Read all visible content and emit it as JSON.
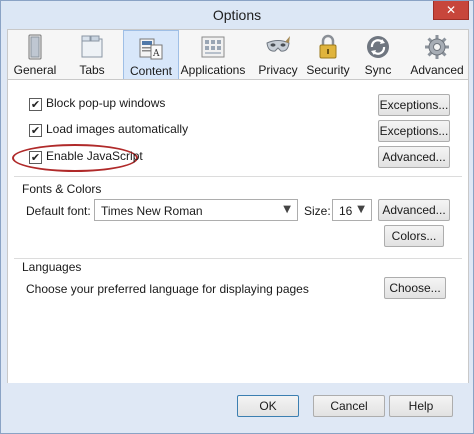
{
  "window": {
    "title": "Options",
    "close_glyph": "✕"
  },
  "tabs": [
    {
      "label": "General",
      "icon": "general-icon"
    },
    {
      "label": "Tabs",
      "icon": "tabs-icon"
    },
    {
      "label": "Content",
      "icon": "content-icon",
      "selected": true
    },
    {
      "label": "Applications",
      "icon": "applications-icon"
    },
    {
      "label": "Privacy",
      "icon": "privacy-mask-icon"
    },
    {
      "label": "Security",
      "icon": "padlock-icon"
    },
    {
      "label": "Sync",
      "icon": "sync-icon"
    },
    {
      "label": "Advanced",
      "icon": "gear-icon"
    }
  ],
  "content": {
    "block_popups": {
      "label": "Block pop-up windows",
      "checked": true,
      "button": "Exceptions..."
    },
    "load_images": {
      "label": "Load images automatically",
      "checked": true,
      "button": "Exceptions..."
    },
    "enable_js": {
      "label": "Enable JavaScript",
      "checked": true,
      "button": "Advanced..."
    },
    "check_glyph": "✔",
    "fonts": {
      "title": "Fonts & Colors",
      "default_font_label": "Default font:",
      "default_font_value": "Times New Roman",
      "size_label": "Size:",
      "size_value": "16",
      "advanced_button": "Advanced...",
      "colors_button": "Colors..."
    },
    "languages": {
      "title": "Languages",
      "description": "Choose your preferred language for displaying pages",
      "choose_button": "Choose..."
    }
  },
  "footer": {
    "ok": "OK",
    "cancel": "Cancel",
    "help": "Help"
  },
  "colors": {
    "highlight": "#b02a2a",
    "selected_tab": "#d8e7fa",
    "chrome": "#dfe8f5"
  }
}
